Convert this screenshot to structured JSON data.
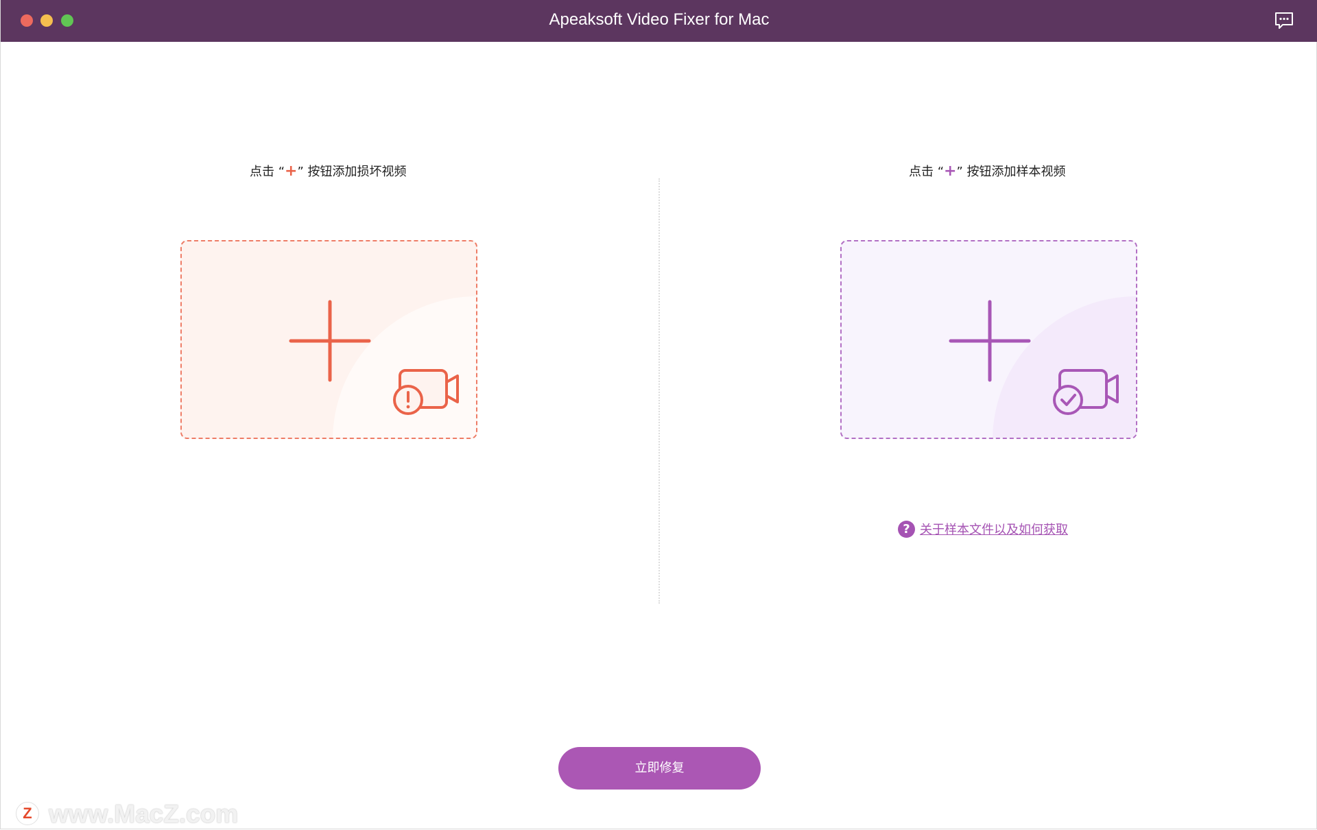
{
  "window": {
    "title": "Apeaksoft Video Fixer for Mac",
    "icons": {
      "close": "close-traffic-light",
      "minimize": "minimize-traffic-light",
      "maximize": "maximize-traffic-light",
      "feedback": "chat-bubble-icon"
    }
  },
  "left_panel": {
    "instruction_prefix": "点击 “",
    "instruction_plus": "+",
    "instruction_suffix": "” 按钮添加损坏视频",
    "drop_zone_icon": "damaged-video-camera-icon"
  },
  "right_panel": {
    "instruction_prefix": "点击 “",
    "instruction_plus": "+",
    "instruction_suffix": "” 按钮添加样本视频",
    "drop_zone_icon": "sample-video-camera-icon",
    "help_icon_glyph": "?",
    "help_link": "关于样本文件以及如何获取"
  },
  "actions": {
    "repair_button": "立即修复"
  },
  "watermark": {
    "logo_letter": "Z",
    "text": "www.MacZ.com"
  },
  "colors": {
    "titlebar": "#5c365f",
    "accent_red": "#ea6349",
    "accent_purple": "#a857b6",
    "button": "#ab57b4"
  }
}
